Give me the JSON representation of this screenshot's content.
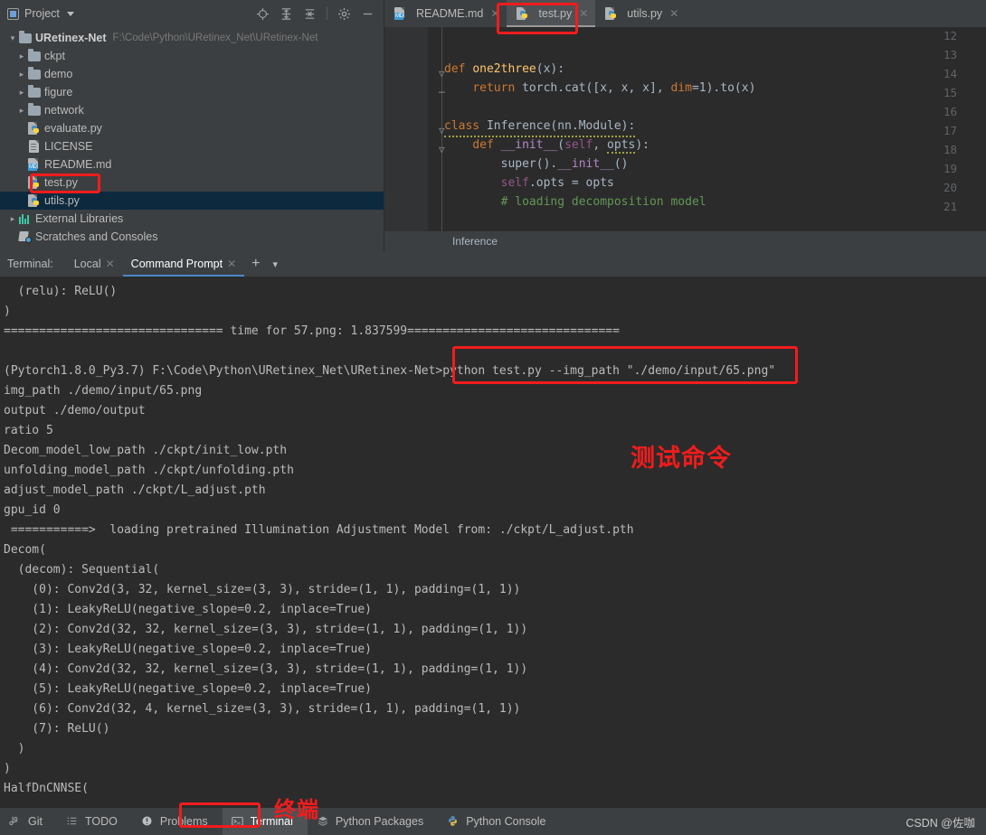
{
  "project_panel": {
    "title": "Project",
    "tools": [
      "locate-icon",
      "expand-all-icon",
      "collapse-all-icon",
      "settings-icon",
      "minimize-icon"
    ],
    "tree": [
      {
        "label": "URetinex-Net",
        "path": "F:\\Code\\Python\\URetinex_Net\\URetinex-Net",
        "icon": "folder-icon",
        "state": "expanded",
        "depth": 0,
        "bold": true,
        "selected": false
      },
      {
        "label": "ckpt",
        "path": "",
        "icon": "folder-icon",
        "state": "collapsed",
        "depth": 1,
        "bold": false,
        "selected": false
      },
      {
        "label": "demo",
        "path": "",
        "icon": "folder-icon",
        "state": "collapsed",
        "depth": 1,
        "bold": false,
        "selected": false
      },
      {
        "label": "figure",
        "path": "",
        "icon": "folder-icon",
        "state": "collapsed",
        "depth": 1,
        "bold": false,
        "selected": false
      },
      {
        "label": "network",
        "path": "",
        "icon": "folder-icon",
        "state": "collapsed",
        "depth": 1,
        "bold": false,
        "selected": false
      },
      {
        "label": "evaluate.py",
        "path": "",
        "icon": "python-file-icon",
        "state": "leaf",
        "depth": 2,
        "bold": false,
        "selected": false
      },
      {
        "label": "LICENSE",
        "path": "",
        "icon": "text-file-icon",
        "state": "leaf",
        "depth": 2,
        "bold": false,
        "selected": false
      },
      {
        "label": "README.md",
        "path": "",
        "icon": "markdown-file-icon",
        "state": "leaf",
        "depth": 2,
        "bold": false,
        "selected": false
      },
      {
        "label": "test.py",
        "path": "",
        "icon": "python-file-icon",
        "state": "leaf",
        "depth": 2,
        "bold": false,
        "selected": false
      },
      {
        "label": "utils.py",
        "path": "",
        "icon": "python-file-icon",
        "state": "leaf",
        "depth": 2,
        "bold": false,
        "selected": true
      },
      {
        "label": "External Libraries",
        "path": "",
        "icon": "libraries-icon",
        "state": "collapsed",
        "depth": 0,
        "bold": false,
        "selected": false
      },
      {
        "label": "Scratches and Consoles",
        "path": "",
        "icon": "scratches-icon",
        "state": "leaf",
        "depth": 0,
        "bold": false,
        "selected": false
      }
    ]
  },
  "editor": {
    "tabs": [
      {
        "label": "README.md",
        "icon": "markdown-file-icon",
        "active": false
      },
      {
        "label": "test.py",
        "icon": "python-file-icon",
        "active": true
      },
      {
        "label": "utils.py",
        "icon": "python-file-icon",
        "active": false
      }
    ],
    "line_numbers": [
      "12",
      "13",
      "14",
      "15",
      "16",
      "17",
      "18",
      "19",
      "20",
      "21"
    ],
    "code_lines": [
      "",
      "",
      "def one2three(x):",
      "    return torch.cat([x, x, x], dim=1).to(x)",
      "",
      "class Inference(nn.Module):",
      "    def __init__(self, opts):",
      "        super().__init__()",
      "        self.opts = opts",
      "        # loading decomposition model"
    ],
    "breadcrumb": "Inference"
  },
  "terminal": {
    "label": "Terminal:",
    "tabs": [
      {
        "label": "Local",
        "active": false
      },
      {
        "label": "Command Prompt",
        "active": true
      }
    ],
    "add_tab_label": "+",
    "dropdown_label": "⌄",
    "lines": [
      "  (relu): ReLU()",
      ")",
      "=============================== time for 57.png: 1.837599==============================",
      "",
      "(Pytorch1.8.0_Py3.7) F:\\Code\\Python\\URetinex_Net\\URetinex-Net>python test.py --img_path \"./demo/input/65.png\"",
      "img_path ./demo/input/65.png",
      "output ./demo/output",
      "ratio 5",
      "Decom_model_low_path ./ckpt/init_low.pth",
      "unfolding_model_path ./ckpt/unfolding.pth",
      "adjust_model_path ./ckpt/L_adjust.pth",
      "gpu_id 0",
      " ===========>  loading pretrained Illumination Adjustment Model from: ./ckpt/L_adjust.pth",
      "Decom(",
      "  (decom): Sequential(",
      "    (0): Conv2d(3, 32, kernel_size=(3, 3), stride=(1, 1), padding=(1, 1))",
      "    (1): LeakyReLU(negative_slope=0.2, inplace=True)",
      "    (2): Conv2d(32, 32, kernel_size=(3, 3), stride=(1, 1), padding=(1, 1))",
      "    (3): LeakyReLU(negative_slope=0.2, inplace=True)",
      "    (4): Conv2d(32, 32, kernel_size=(3, 3), stride=(1, 1), padding=(1, 1))",
      "    (5): LeakyReLU(negative_slope=0.2, inplace=True)",
      "    (6): Conv2d(32, 4, kernel_size=(3, 3), stride=(1, 1), padding=(1, 1))",
      "    (7): ReLU()",
      "  )",
      ")",
      "HalfDnCNNSE("
    ]
  },
  "statusbar": {
    "items": [
      {
        "label": "Git",
        "icon": "git-branch-icon",
        "active": false
      },
      {
        "label": "TODO",
        "icon": "todo-list-icon",
        "active": false
      },
      {
        "label": "Problems",
        "icon": "problems-icon",
        "active": false
      },
      {
        "label": "Terminal",
        "icon": "terminal-icon",
        "active": true
      },
      {
        "label": "Python Packages",
        "icon": "packages-icon",
        "active": false
      },
      {
        "label": "Python Console",
        "icon": "python-console-icon",
        "active": false
      }
    ],
    "watermark": "CSDN @佐咖"
  },
  "annotations": {
    "accent_red": "#f11c1c",
    "test_command_label": "测试命令",
    "terminal_label": "终端"
  }
}
